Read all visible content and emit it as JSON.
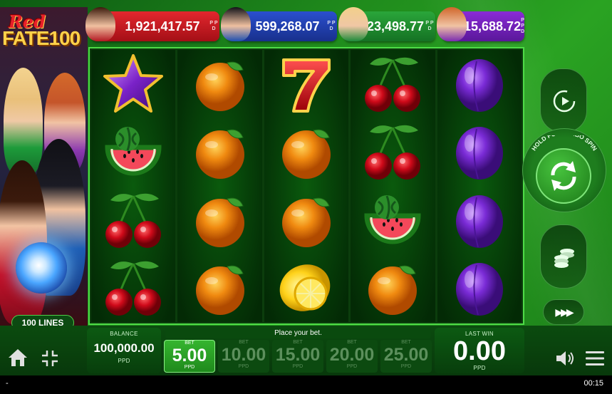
{
  "game": {
    "logo_line1": "Red",
    "logo_line2": "FATE",
    "logo_number": "100",
    "lines_label": "100 LINES"
  },
  "jackpots": [
    {
      "value": "1,921,417.57",
      "unit": "P P D",
      "color": "#c8161e"
    },
    {
      "value": "599,268.07",
      "unit": "P P D",
      "color": "#2140b0"
    },
    {
      "value": "23,498.77",
      "unit": "P P D",
      "color": "#1e8a2c"
    },
    {
      "value": "15,688.72",
      "unit": "P P D",
      "color": "#7320bb"
    }
  ],
  "reels": [
    [
      "star",
      "watermelon",
      "cherry",
      "cherry"
    ],
    [
      "orange",
      "orange",
      "orange",
      "orange"
    ],
    [
      "seven",
      "orange",
      "orange",
      "lemon"
    ],
    [
      "cherry",
      "cherry",
      "watermelon",
      "orange"
    ],
    [
      "plum",
      "plum",
      "plum",
      "plum"
    ]
  ],
  "controls": {
    "turbo_hint": "HOLD FOR TURBO SPIN",
    "autoplay_icon": "replay-icon",
    "spin_icon": "refresh-arrows-icon",
    "coins_icon": "coin-stack-icon",
    "turbo_icon": "fast-forward-icon",
    "turbo_glyph": "▶▶▶"
  },
  "bottom": {
    "balance_label": "BALANCE",
    "balance_value": "100,000.00",
    "balance_unit": "PPD",
    "place_bet": "Place your bet.",
    "bets": [
      {
        "label": "BET",
        "value": "5.00",
        "unit": "PPD",
        "active": true
      },
      {
        "label": "BET",
        "value": "10.00",
        "unit": "PPD",
        "active": false
      },
      {
        "label": "BET",
        "value": "15.00",
        "unit": "PPD",
        "active": false
      },
      {
        "label": "BET",
        "value": "20.00",
        "unit": "PPD",
        "active": false
      },
      {
        "label": "BET",
        "value": "25.00",
        "unit": "PPD",
        "active": false
      }
    ],
    "last_win_label": "LAST WIN",
    "last_win_value": "0.00",
    "last_win_unit": "PPD"
  },
  "status_bar": {
    "left": "-",
    "time": "00:15"
  }
}
